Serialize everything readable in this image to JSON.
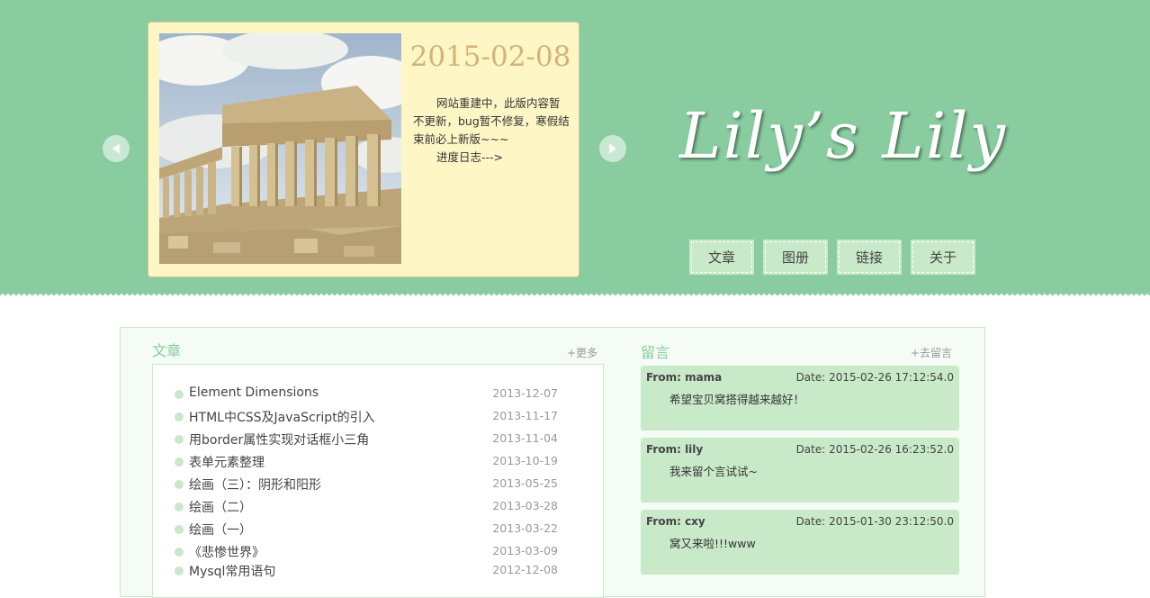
{
  "slider": {
    "date": "2015-02-08",
    "text_line1": "网站重建中，此版内容暂不更新，bug暂不修复，寒假结束前必上新版~~~",
    "text_line2": "进度日志--->"
  },
  "logo": {
    "text": "Lily’s Lily"
  },
  "nav": [
    {
      "label": "文章"
    },
    {
      "label": "图册"
    },
    {
      "label": "链接"
    },
    {
      "label": "关于"
    }
  ],
  "articles": {
    "title": "文章",
    "more": "+更多",
    "items": [
      {
        "title": "Element Dimensions",
        "date": "2013-12-07"
      },
      {
        "title": "HTML中CSS及JavaScript的引入",
        "date": "2013-11-17"
      },
      {
        "title": "用border属性实现对话框小三角",
        "date": "2013-11-04"
      },
      {
        "title": "表单元素整理",
        "date": "2013-10-19"
      },
      {
        "title": "绘画（三）：阴形和阳形",
        "date": "2013-05-25"
      },
      {
        "title": "绘画（二）",
        "date": "2013-03-28"
      },
      {
        "title": "绘画（一）",
        "date": "2013-03-22"
      },
      {
        "title": "《悲惨世界》",
        "date": "2013-03-09"
      },
      {
        "title": "Mysql常用语句",
        "date": "2012-12-08"
      }
    ]
  },
  "messages": {
    "title": "留言",
    "more": "+去留言",
    "items": [
      {
        "from": "From: mama",
        "date": "Date: 2015-02-26 17:12:54.0",
        "body": "希望宝贝窝搭得越来越好！"
      },
      {
        "from": "From: lily",
        "date": "Date: 2015-02-26 16:23:52.0",
        "body": "我来留个言试试~"
      },
      {
        "from": "From: cxy",
        "date": "Date: 2015-01-30 23:12:50.0",
        "body": "窝又来啦!!!www"
      }
    ]
  },
  "colors": {
    "header_bg": "#88cc9f",
    "card_bg": "#fff6c6",
    "accent_date": "#d3b377",
    "message_bg": "#c8eac9"
  }
}
